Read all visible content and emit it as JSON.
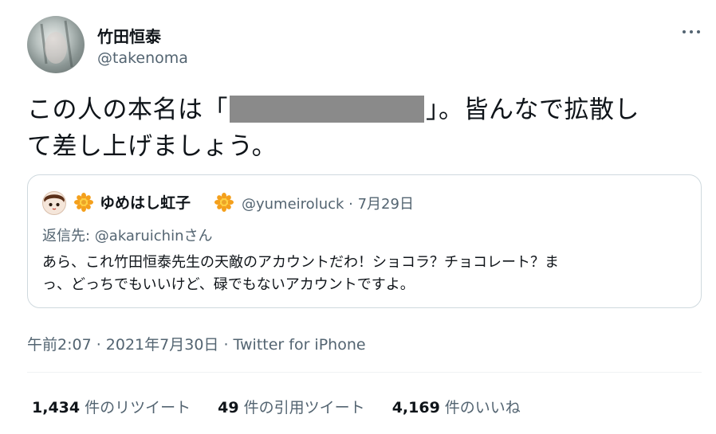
{
  "author": {
    "display_name": "竹田恒泰",
    "handle": "@takenoma"
  },
  "tweet": {
    "text_line1_a": "この人の本名は「",
    "text_line1_b": "」。皆んなで拡散し",
    "text_line2": "て差し上げましょう。"
  },
  "quoted_tweet": {
    "display_name": "ゆめはし虹子",
    "handle_date": "@yumeiroluck · 7月29日",
    "reply_prefix": "返信先: ",
    "reply_to": "@akaruichinさん",
    "text_line1": "あら、これ竹田恒泰先生の天敵のアカウントだわ！ショコラ？チョコレート？ま",
    "text_line2": "っ、どっちでもいいけど、碌でもないアカウントですよ。"
  },
  "meta": {
    "time": "午前2:07",
    "sep1": " · ",
    "date": "2021年7月30日",
    "sep2": " · ",
    "source": "Twitter for iPhone"
  },
  "stats": {
    "retweets_count": "1,434",
    "retweets_label": "件のリツイート",
    "quotes_count": "49",
    "quotes_label": "件の引用ツイート",
    "likes_count": "4,169",
    "likes_label": "件のいいね"
  },
  "icons": [
    "more-icon",
    "avatar",
    "quoted-avatar",
    "sunflower-icon"
  ],
  "colors": {
    "text": "#0f1419",
    "secondary": "#536471",
    "border": "#cfd9de",
    "redaction": "#8a8a8a",
    "sunflower": "#f4a01c"
  }
}
